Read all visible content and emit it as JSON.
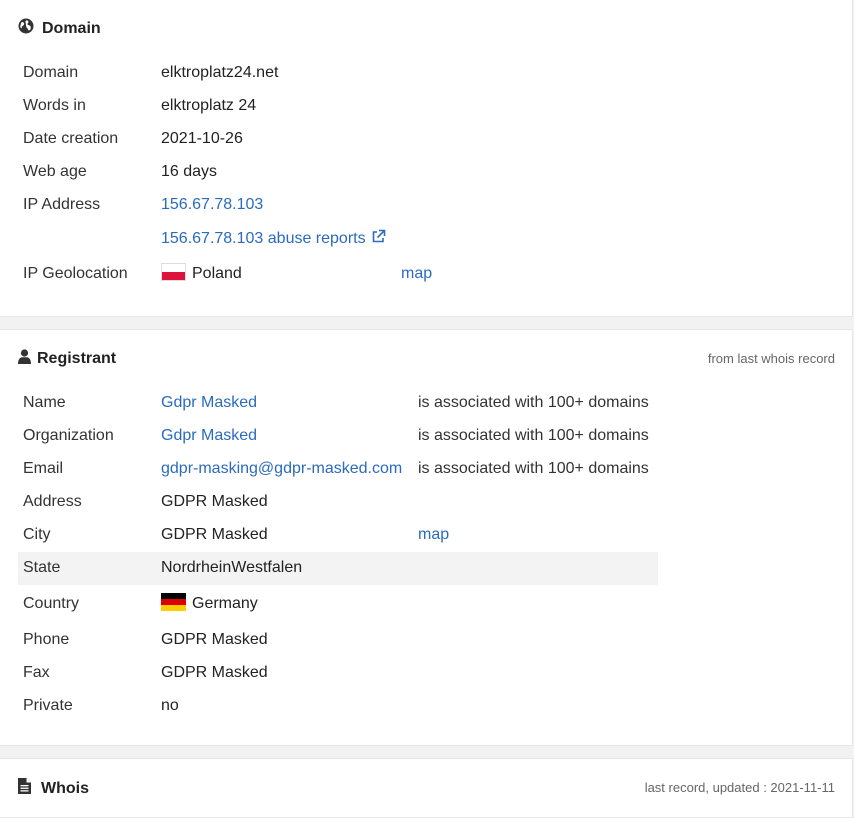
{
  "domain_section": {
    "title": "Domain",
    "icon": "globe-icon",
    "rows": {
      "domain": {
        "label": "Domain",
        "value": "elktroplatz24.net"
      },
      "words": {
        "label": "Words in",
        "value": "elktroplatz 24"
      },
      "created": {
        "label": "Date creation",
        "value": "2021-10-26"
      },
      "age": {
        "label": "Web age",
        "value": "16 days"
      },
      "ip": {
        "label": "IP Address",
        "value": "156.67.78.103"
      },
      "abuse": {
        "value": "156.67.78.103 abuse reports"
      },
      "geo": {
        "label": "IP Geolocation",
        "value": "Poland",
        "map": "map"
      }
    }
  },
  "registrant_section": {
    "title": "Registrant",
    "icon": "user-icon",
    "note": "from last whois record",
    "rows": {
      "name": {
        "label": "Name",
        "value": "Gdpr Masked",
        "assoc": "is associated with 100+ domains"
      },
      "org": {
        "label": "Organization",
        "value": "Gdpr Masked",
        "assoc": "is associated with 100+ domains"
      },
      "email": {
        "label": "Email",
        "value": "gdpr-masking@gdpr-masked.com",
        "assoc": "is associated with 100+ domains"
      },
      "address": {
        "label": "Address",
        "value": "GDPR Masked"
      },
      "city": {
        "label": "City",
        "value": "GDPR Masked",
        "map": "map"
      },
      "state": {
        "label": "State",
        "value": "NordrheinWestfalen"
      },
      "country": {
        "label": "Country",
        "value": "Germany"
      },
      "phone": {
        "label": "Phone",
        "value": "GDPR Masked"
      },
      "fax": {
        "label": "Fax",
        "value": "GDPR Masked"
      },
      "private": {
        "label": "Private",
        "value": "no"
      }
    }
  },
  "whois_section": {
    "title": "Whois",
    "icon": "document-icon",
    "note": "last record, updated : 2021-11-11"
  },
  "colors": {
    "link": "#2a6bbd",
    "highlight_row": "#f3f3f3"
  }
}
